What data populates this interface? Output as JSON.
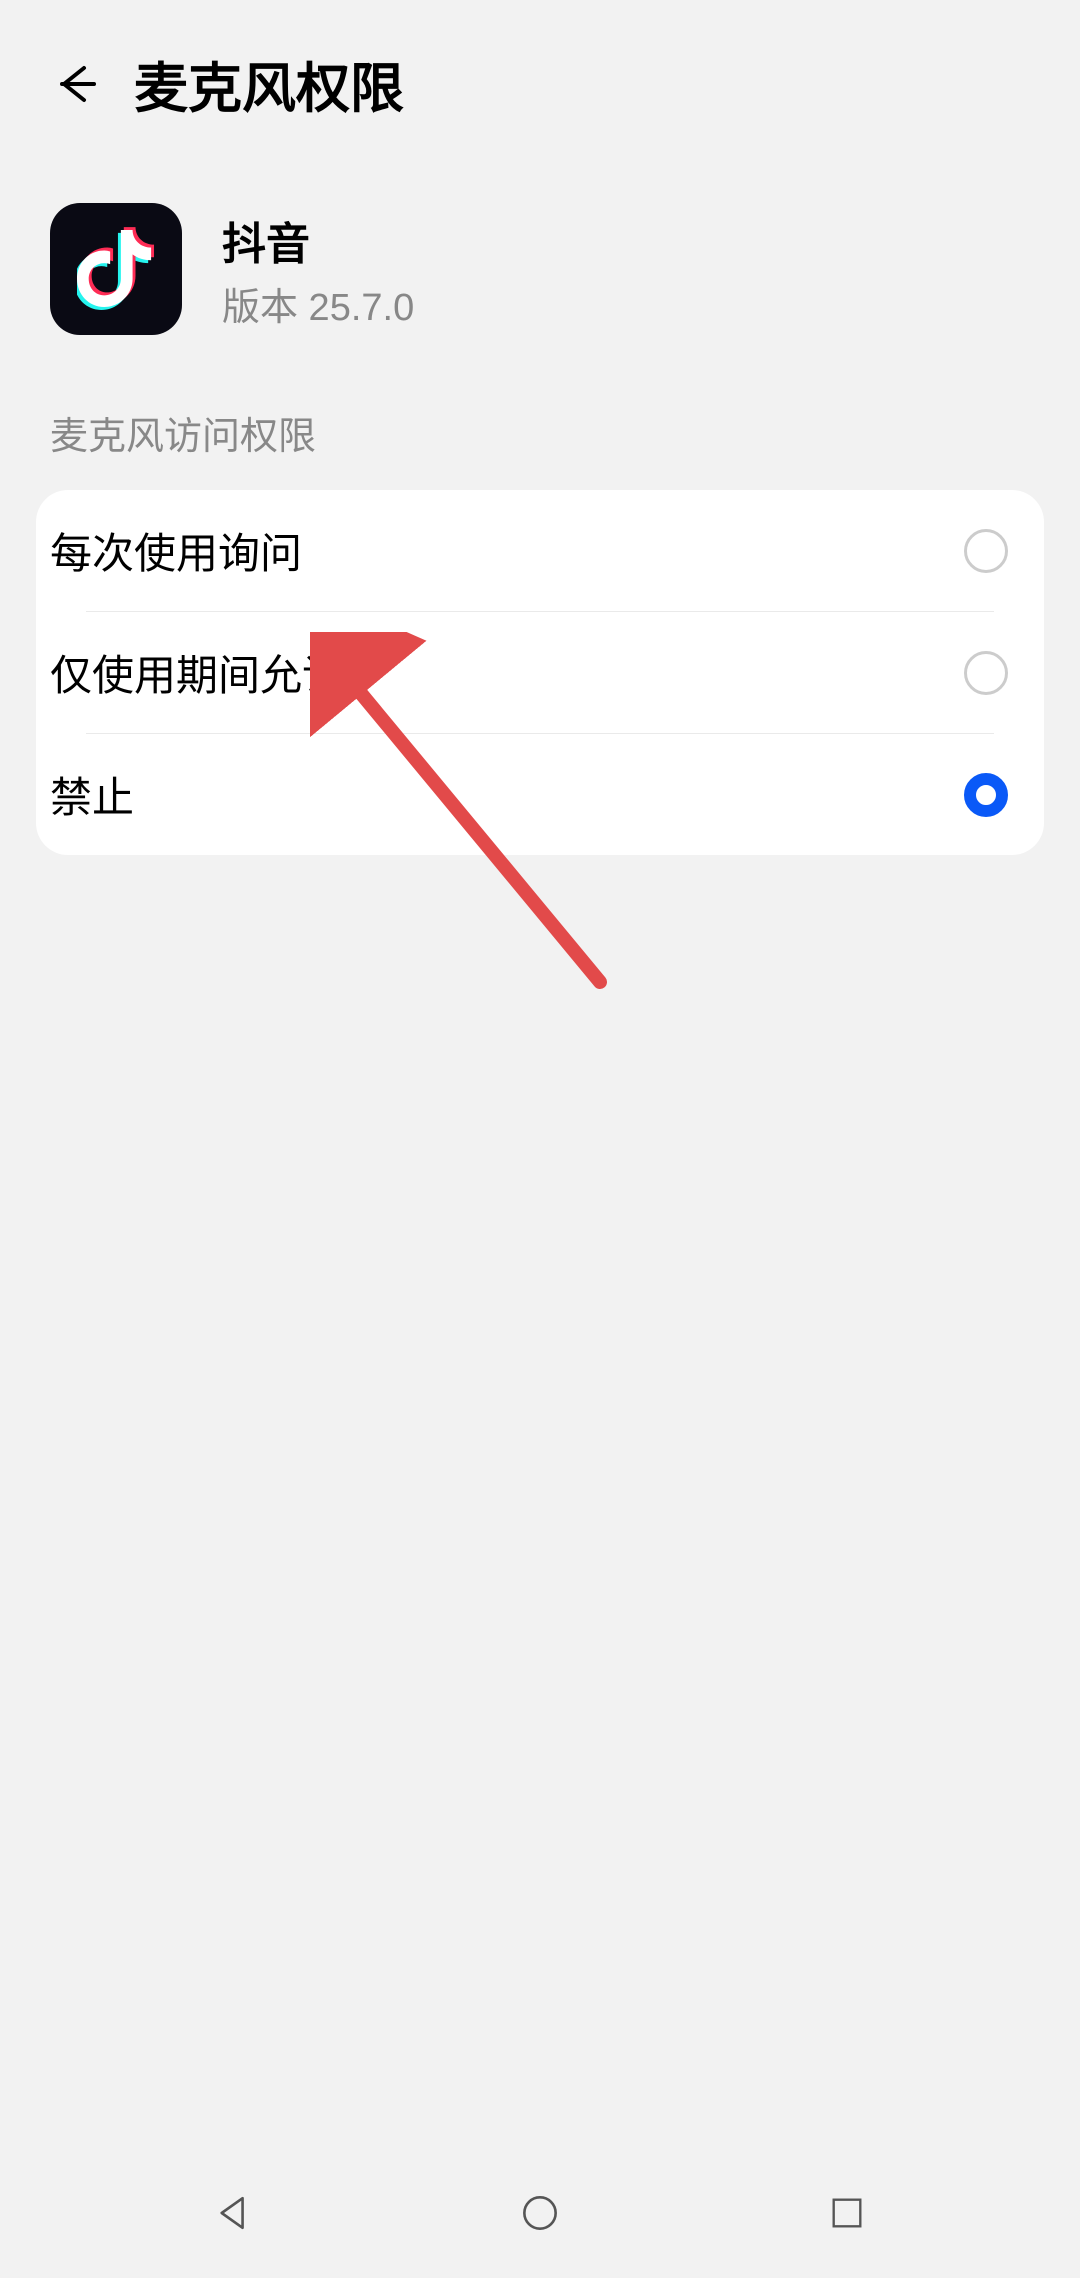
{
  "header": {
    "title": "麦克风权限"
  },
  "app": {
    "name": "抖音",
    "version_label": "版本 25.7.0"
  },
  "section": {
    "label": "麦克风访问权限"
  },
  "options": [
    {
      "label": "每次使用询问",
      "selected": false
    },
    {
      "label": "仅使用期间允许",
      "selected": false
    },
    {
      "label": "禁止",
      "selected": true
    }
  ],
  "colors": {
    "accent": "#0a59f7",
    "annotation": "#e24a4a"
  }
}
